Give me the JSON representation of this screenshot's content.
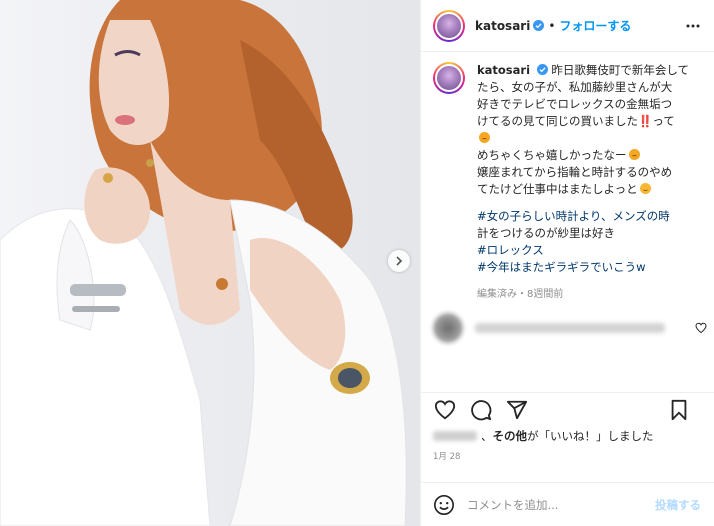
{
  "header": {
    "username": "katosari",
    "separator": "•",
    "follow_label": "フォローする",
    "more_icon": "more-horizontal-icon"
  },
  "caption": {
    "username": "katosari",
    "lines": [
      "昨日歌舞伎町で新年会して",
      "たら、女の子が、私加藤紗里さんが大",
      "好きでテレビでロレックスの金無垢つ",
      "けてるの見て同じの買いました‼️って",
      "めちゃくちゃ嬉しかったなー",
      "嬢座まれてから指輪と時計するのやめ",
      "てたけど仕事中はまたしよっと"
    ],
    "hashtag_lines": [
      "#女の子らしい時計より、メンズの時",
      "計をつけるのが紗里は好き",
      "#ロレックス",
      "#今年はまたギラギラでいこうw"
    ],
    "meta": "編集済み・8週間前"
  },
  "actions": {
    "like_icon": "heart-outline-icon",
    "comment_icon": "comment-icon",
    "share_icon": "send-icon",
    "save_icon": "bookmark-icon"
  },
  "likes": {
    "text": "、その他が「いいね！」しました",
    "bold_part": "その他"
  },
  "date": "1月 28",
  "comment_bar": {
    "placeholder": "コメントを追加...",
    "post_label": "投稿する",
    "emoji_icon": "smiley-icon"
  },
  "colors": {
    "accent": "#0095f6",
    "hashtag": "#00376b",
    "muted": "#8e8e8e",
    "post_disabled": "#b3dbff"
  }
}
